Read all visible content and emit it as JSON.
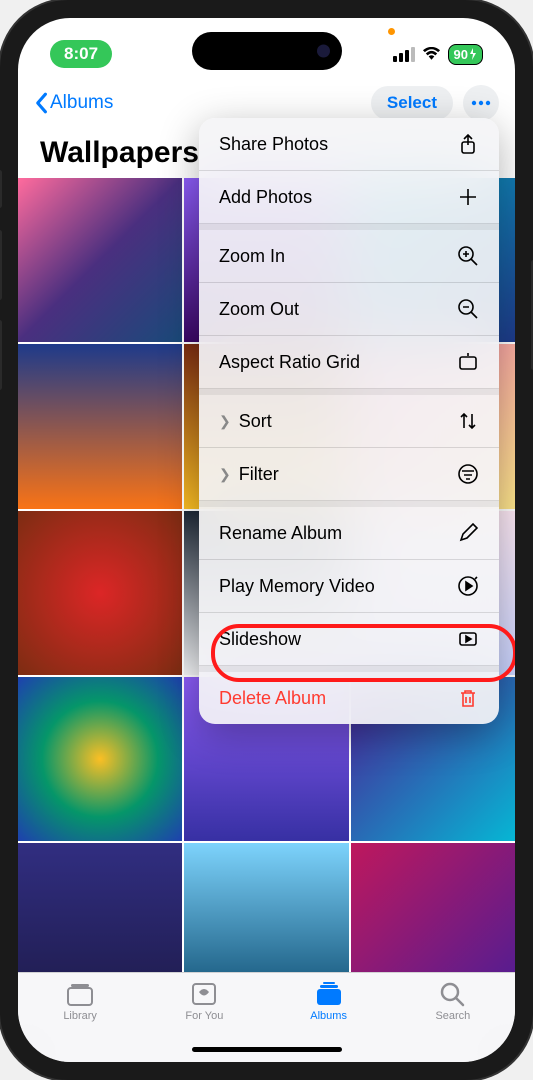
{
  "status": {
    "time": "8:07",
    "battery": "90"
  },
  "nav": {
    "back_label": "Albums",
    "select_label": "Select"
  },
  "album": {
    "title": "Wallpapers"
  },
  "menu": {
    "share": "Share Photos",
    "add": "Add Photos",
    "zoom_in": "Zoom In",
    "zoom_out": "Zoom Out",
    "aspect": "Aspect Ratio Grid",
    "sort": "Sort",
    "filter": "Filter",
    "rename": "Rename Album",
    "memory": "Play Memory Video",
    "slideshow": "Slideshow",
    "delete": "Delete Album"
  },
  "tabs": {
    "library": "Library",
    "for_you": "For You",
    "albums": "Albums",
    "search": "Search"
  }
}
